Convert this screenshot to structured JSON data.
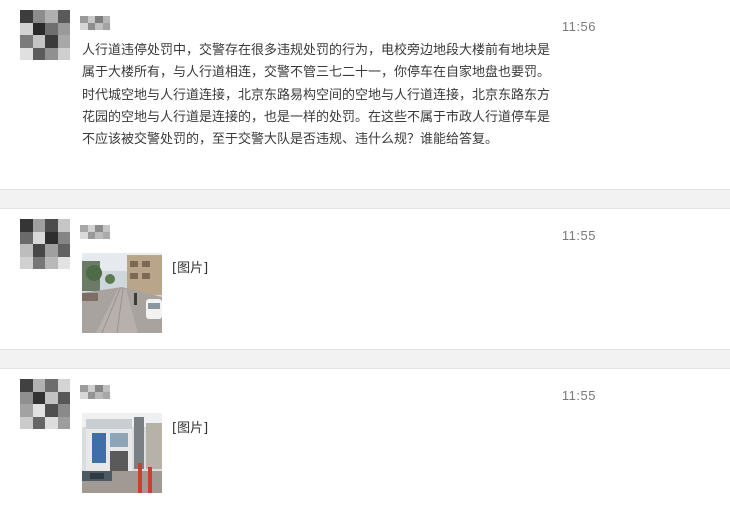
{
  "messages": [
    {
      "time": "11:56",
      "text": "人行道违停处罚中，交警存在很多违规处罚的行为，电校旁边地段大楼前有地块是属于大楼所有，与人行道相连，交警不管三七二十一，你停车在自家地盘也要罚。时代城空地与人行道连接，北京东路易构空间的空地与人行道连接，北京东路东方花园的空地与人行道是连接的，也是一样的处罚。在这些不属于市政人行道停车是不应该被交警处罚的，至于交警大队是否违规、违什么规？谁能给答复。"
    },
    {
      "time": "11:55",
      "image_label": "[图片]"
    },
    {
      "time": "11:55",
      "image_label": "[图片]"
    }
  ],
  "avatar_pattern_colors": [
    "#4a4a4a",
    "#8a8a8a",
    "#c9c9c9",
    "#2f2f2f",
    "#a5a5a5",
    "#6e6e6e",
    "#d8d8d8",
    "#555555"
  ]
}
